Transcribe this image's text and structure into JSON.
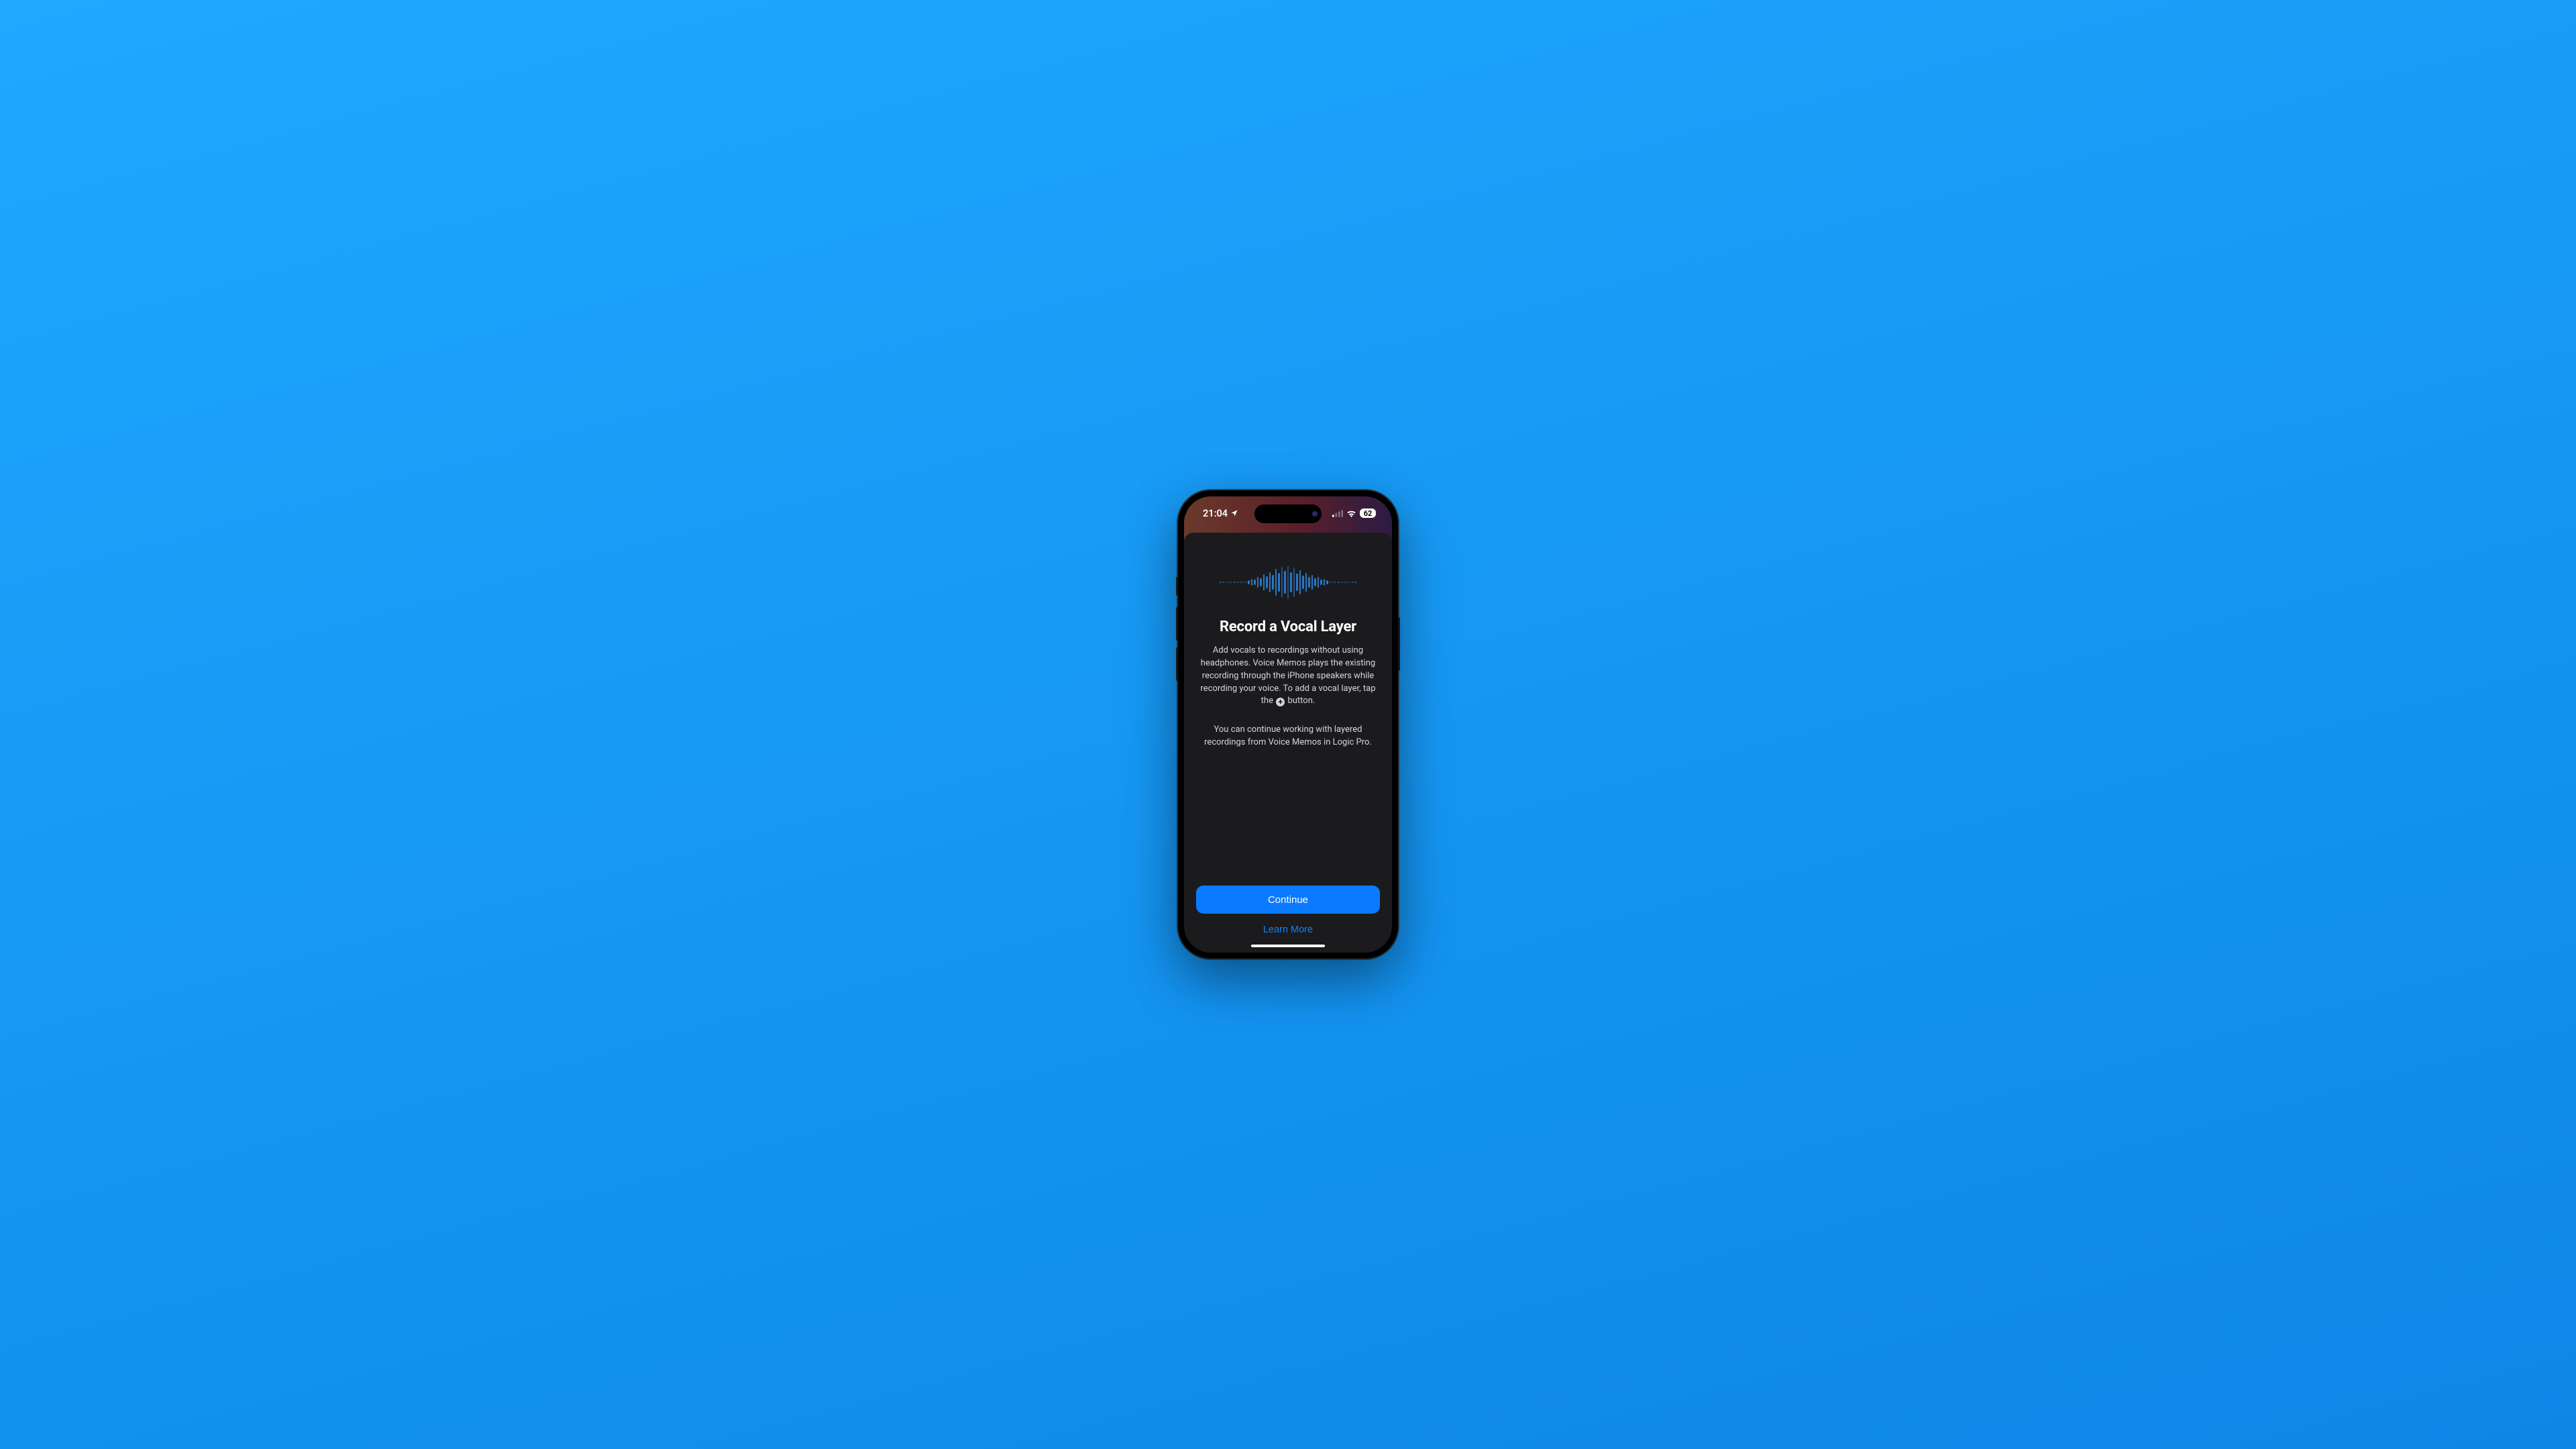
{
  "status": {
    "time": "21:04",
    "battery": "62"
  },
  "modal": {
    "title": "Record a Vocal Layer",
    "body_part1": "Add vocals to recordings without using headphones. Voice Memos plays the existing recording through the iPhone speakers while recording your voice. To add a vocal layer, tap the",
    "body_part2": "button.",
    "body2": "You can continue working with layered recordings from Voice Memos in Logic Pro.",
    "continue_label": "Continue",
    "learn_more_label": "Learn More"
  },
  "colors": {
    "accent": "#0a7aff"
  }
}
